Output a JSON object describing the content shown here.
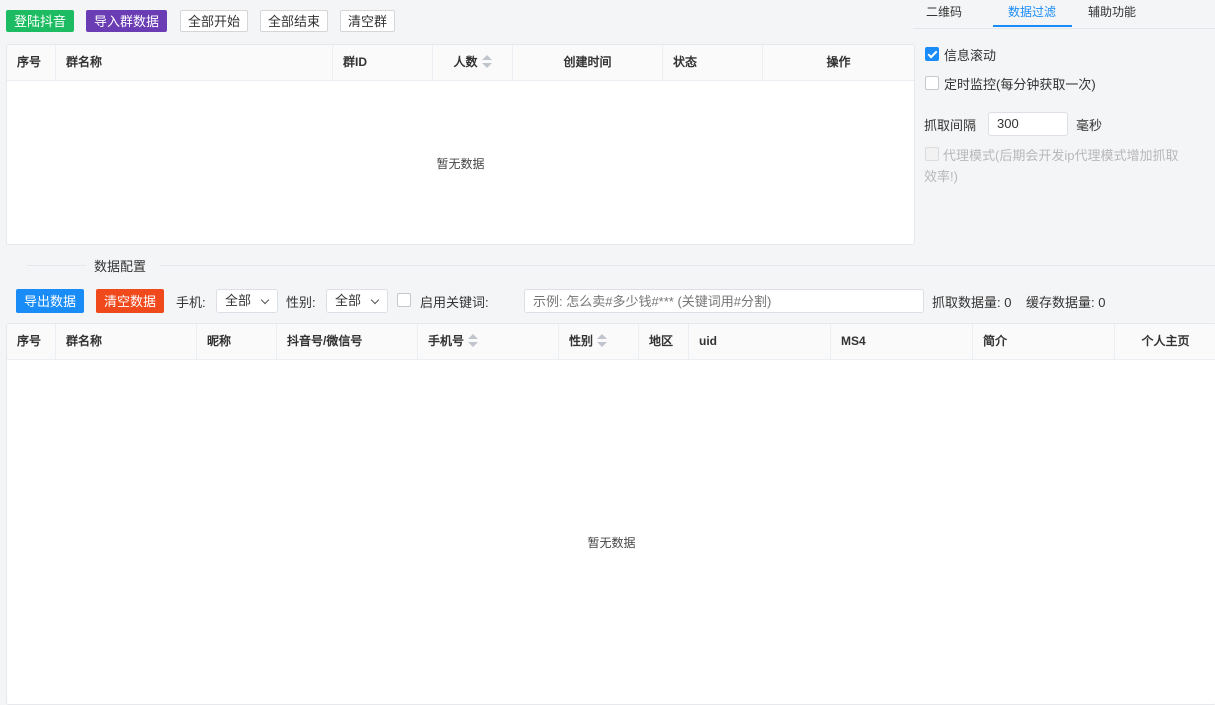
{
  "toolbar": {
    "login": "登陆抖音",
    "import": "导入群数据",
    "start_all": "全部开始",
    "end_all": "全部结束",
    "clear_groups": "清空群"
  },
  "group_table": {
    "columns": [
      "序号",
      "群名称",
      "群ID",
      "人数",
      "创建时间",
      "状态",
      "操作"
    ],
    "empty_text": "暂无数据"
  },
  "side_tabs": {
    "items": [
      "二维码",
      "数据过滤",
      "辅助功能"
    ],
    "active": "数据过滤"
  },
  "filter": {
    "scroll_label": "信息滚动",
    "scroll_checked": true,
    "monitor_label": "定时监控(每分钟获取一次)",
    "monitor_checked": false,
    "interval_label": "抓取间隔",
    "interval_value": "300",
    "interval_unit": "毫秒",
    "proxy_label_1": "代理模式(后期会开发ip代理模式增加抓取",
    "proxy_label_2": "效率!)",
    "proxy_checked": false
  },
  "data_config": {
    "section_title": "数据配置",
    "export": "导出数据",
    "clear_data": "清空数据",
    "phone_label": "手机:",
    "phone_value": "全部",
    "gender_label": "性别:",
    "gender_value": "全部",
    "keyword_label": "启用关键词:",
    "keyword_placeholder": "示例: 怎么卖#多少钱#*** (关键词用#分割)",
    "fetched_label": "抓取数据量: 0",
    "cached_label": "缓存数据量: 0"
  },
  "user_table": {
    "columns": [
      "序号",
      "群名称",
      "昵称",
      "抖音号/微信号",
      "手机号",
      "性别",
      "地区",
      "uid",
      "MS4",
      "简介",
      "个人主页"
    ],
    "empty_text": "暂无数据"
  },
  "colors": {
    "green": "#1ebc62",
    "purple": "#6a3db5",
    "blue": "#1a8cf7",
    "orange": "#f0491c"
  }
}
